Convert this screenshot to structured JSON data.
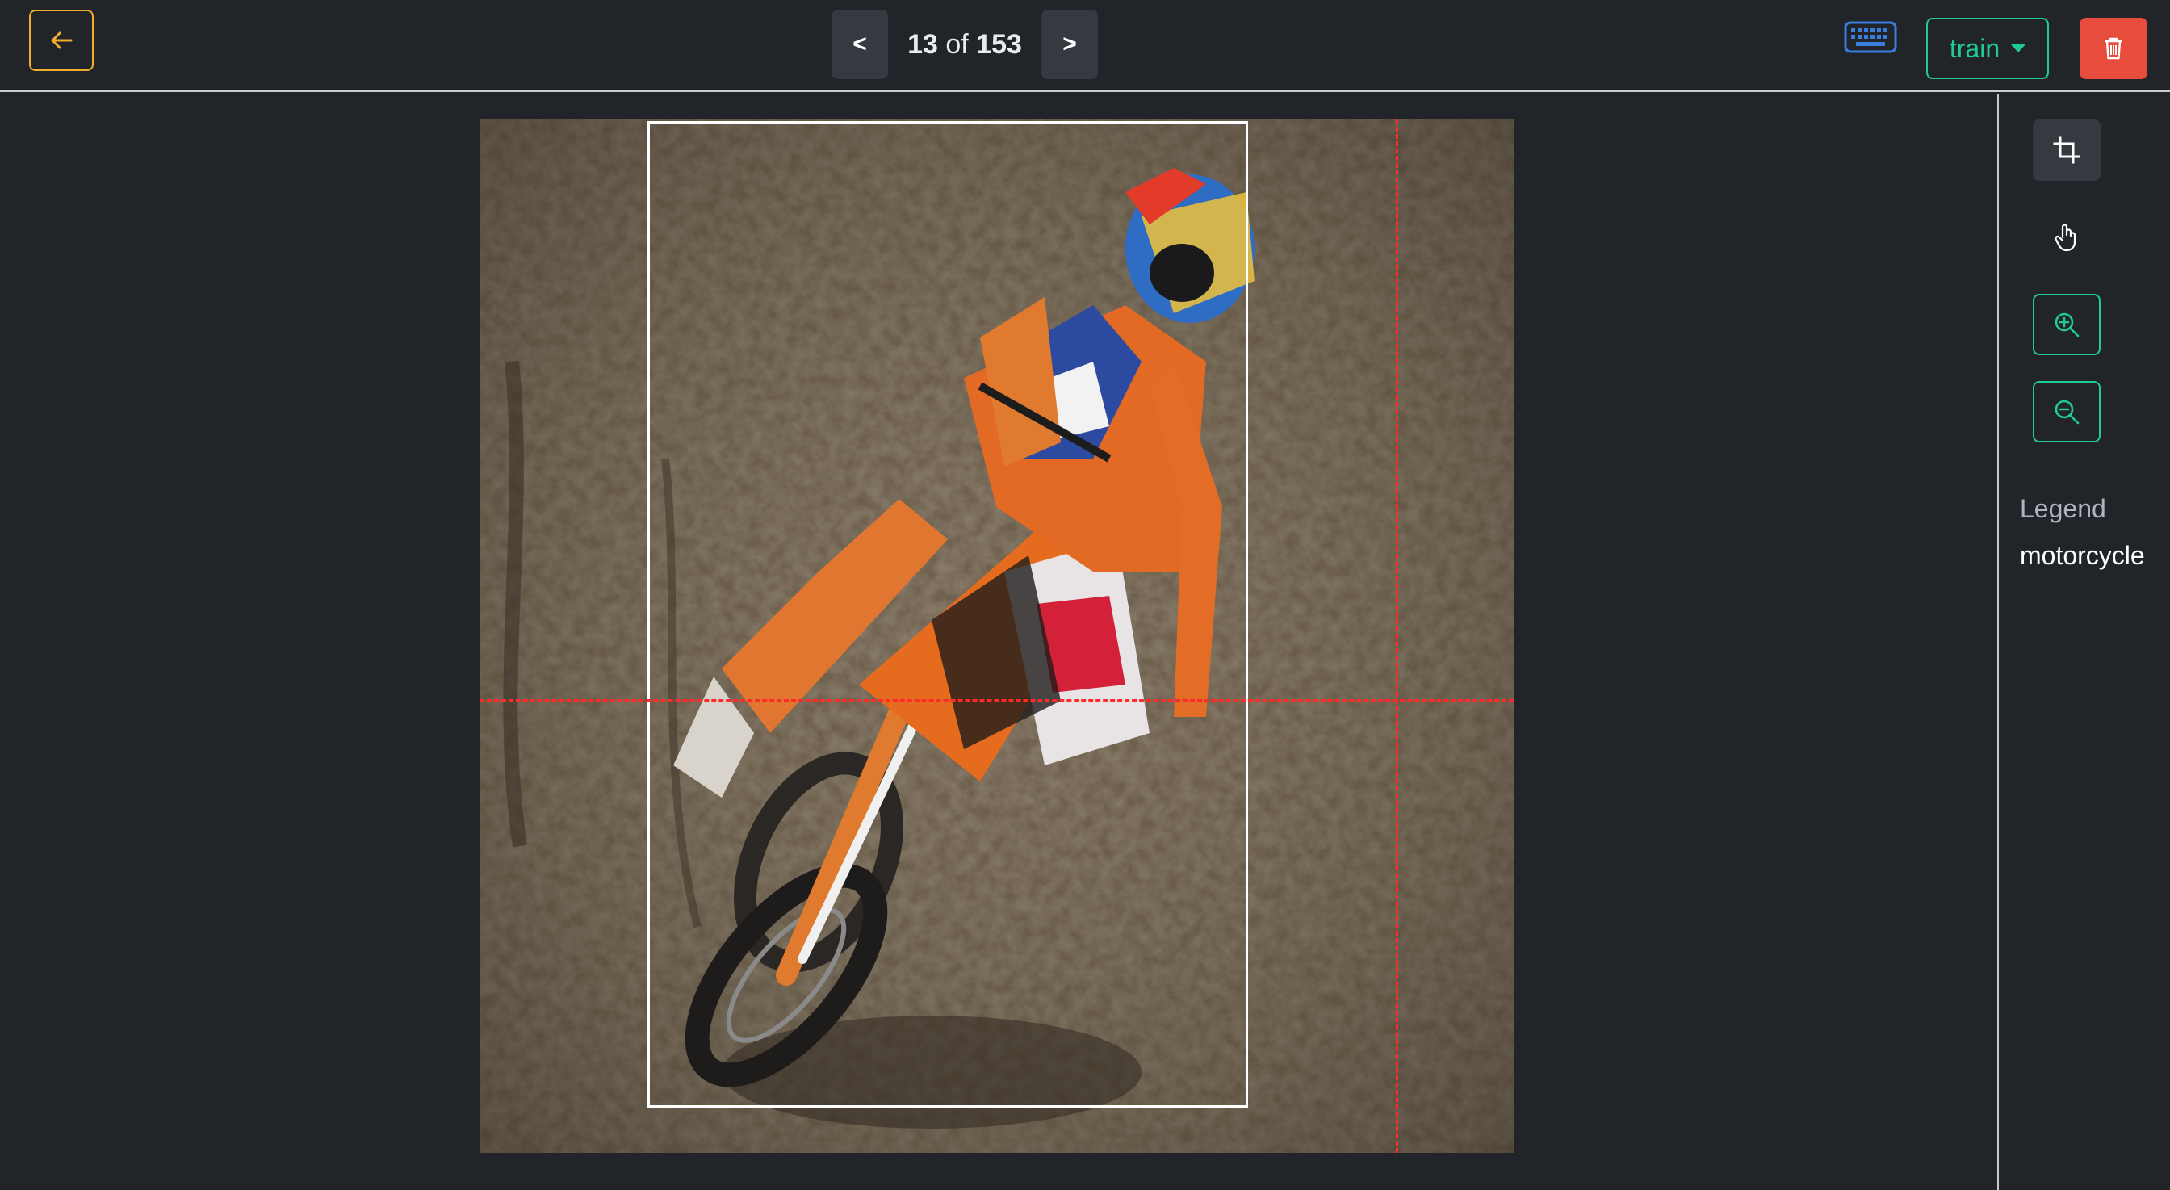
{
  "toolbar": {
    "back_icon": "arrow-left-icon",
    "prev_label": "<",
    "next_label": ">",
    "current_index": "13",
    "of_label": "of",
    "total_count": "153",
    "keyboard_icon": "keyboard-icon",
    "split_value": "train",
    "delete_icon": "trash-icon"
  },
  "sidebar": {
    "tools": [
      "crop-icon",
      "hand-pointer-icon",
      "zoom-in-icon",
      "zoom-out-icon"
    ],
    "legend_title": "Legend",
    "legend_items": [
      "motorcycle"
    ]
  },
  "canvas": {
    "image_subject": "motocross rider on orange dirt bike",
    "annotation_label": "motorcycle"
  },
  "colors": {
    "background": "#212529",
    "accent_warning": "#f0ad2e",
    "accent_success": "#20c997",
    "danger": "#e74c3c",
    "keyboard": "#3b7ddd",
    "guide": "#ff2a2a"
  }
}
